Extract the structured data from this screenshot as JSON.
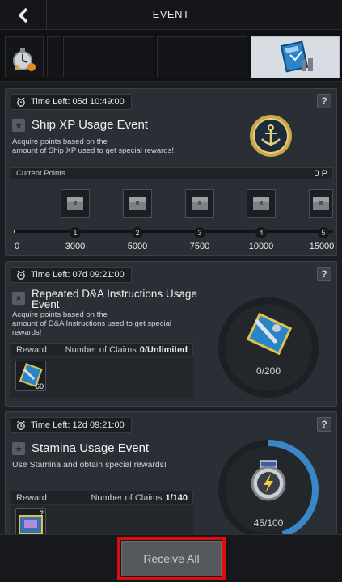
{
  "header": {
    "title": "EVENT"
  },
  "tabs": [
    {
      "name": "timer-event-tab",
      "active": false
    },
    {
      "name": "empty-tab-2",
      "active": false
    },
    {
      "name": "empty-tab-3",
      "active": false
    },
    {
      "name": "empty-tab-4",
      "active": false
    },
    {
      "name": "manual-event-tab",
      "active": true
    }
  ],
  "events": [
    {
      "time_left": "Time Left: 05d 10:49:00",
      "title": "Ship XP Usage Event",
      "description_1": "Acquire points based on the",
      "description_2": "amount of Ship XP used to get special rewards!",
      "current_points_label": "Current Points",
      "current_points_value": "0 P",
      "milestones": [
        {
          "index": "1",
          "value": "3000"
        },
        {
          "index": "2",
          "value": "5000"
        },
        {
          "index": "3",
          "value": "7500"
        },
        {
          "index": "4",
          "value": "10000"
        },
        {
          "index": "5",
          "value": "15000"
        }
      ],
      "track_start": "0",
      "progress": 0
    },
    {
      "time_left": "Time Left: 07d 09:21:00",
      "title": "Repeated D&A Instructions Usage Event",
      "description_1": "Acquire points based on the",
      "description_2": "amount of D&A Instructions used to get special",
      "description_3": "rewards!",
      "reward_label": "Reward",
      "claims_label": "Number of Claims",
      "claims_value": "0/Unlimited",
      "reward_count": "60",
      "ring_text": "0/200",
      "ring_progress": 0
    },
    {
      "time_left": "Time Left: 12d 09:21:00",
      "title": "Stamina Usage Event",
      "description_1": "Use Stamina and obtain special rewards!",
      "reward_label": "Reward",
      "claims_label": "Number of Claims",
      "claims_value": "1/140",
      "ring_text": "45/100",
      "ring_progress": 0.45
    }
  ],
  "help_glyph": "?",
  "footer": {
    "receive_all_label": "Receive All"
  },
  "colors": {
    "accent_ring": "#3a86c8",
    "highlight": "#e10b0b",
    "gold": "#d4bb5c"
  }
}
